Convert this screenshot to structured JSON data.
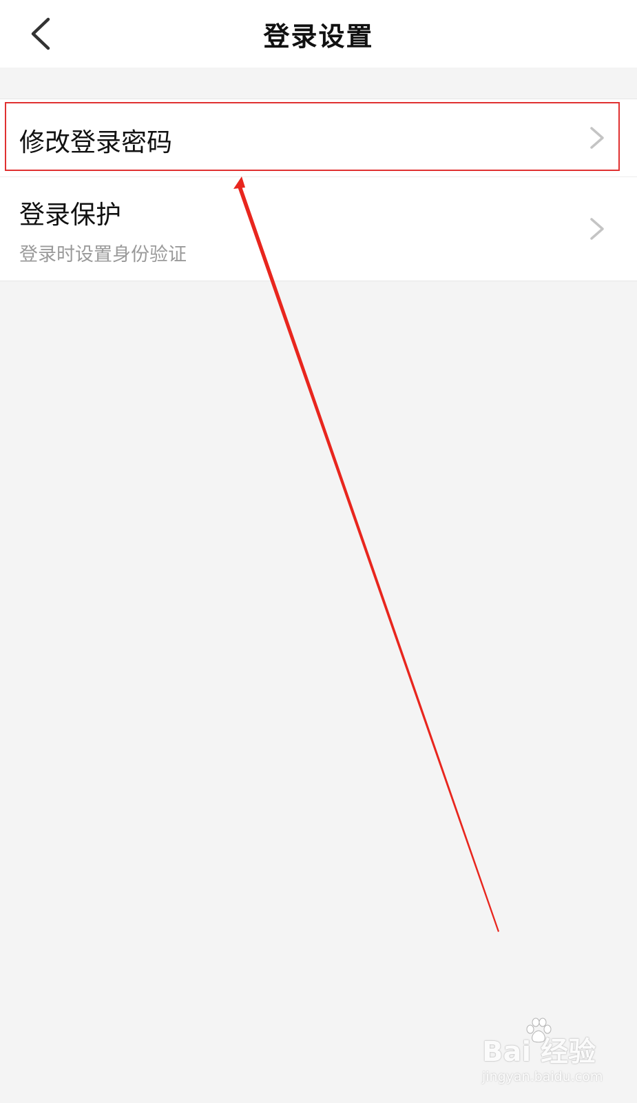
{
  "header": {
    "title": "登录设置",
    "back_icon": "chevron-left-icon"
  },
  "list": {
    "items": [
      {
        "title": "修改登录密码",
        "subtitle": "",
        "icon": "chevron-right-icon"
      },
      {
        "title": "登录保护",
        "subtitle": "登录时设置身份验证",
        "icon": "chevron-right-icon"
      }
    ]
  },
  "annotation": {
    "highlight_color": "#e03030",
    "arrow_color": "#e8261e"
  },
  "watermark": {
    "logo": "Bai 经验",
    "url": "jingyan.baidu.com"
  },
  "colors": {
    "background": "#f4f4f4",
    "surface": "#ffffff",
    "text_primary": "#111111",
    "text_secondary": "#9a9a9a",
    "chevron": "#c4c4c4"
  }
}
